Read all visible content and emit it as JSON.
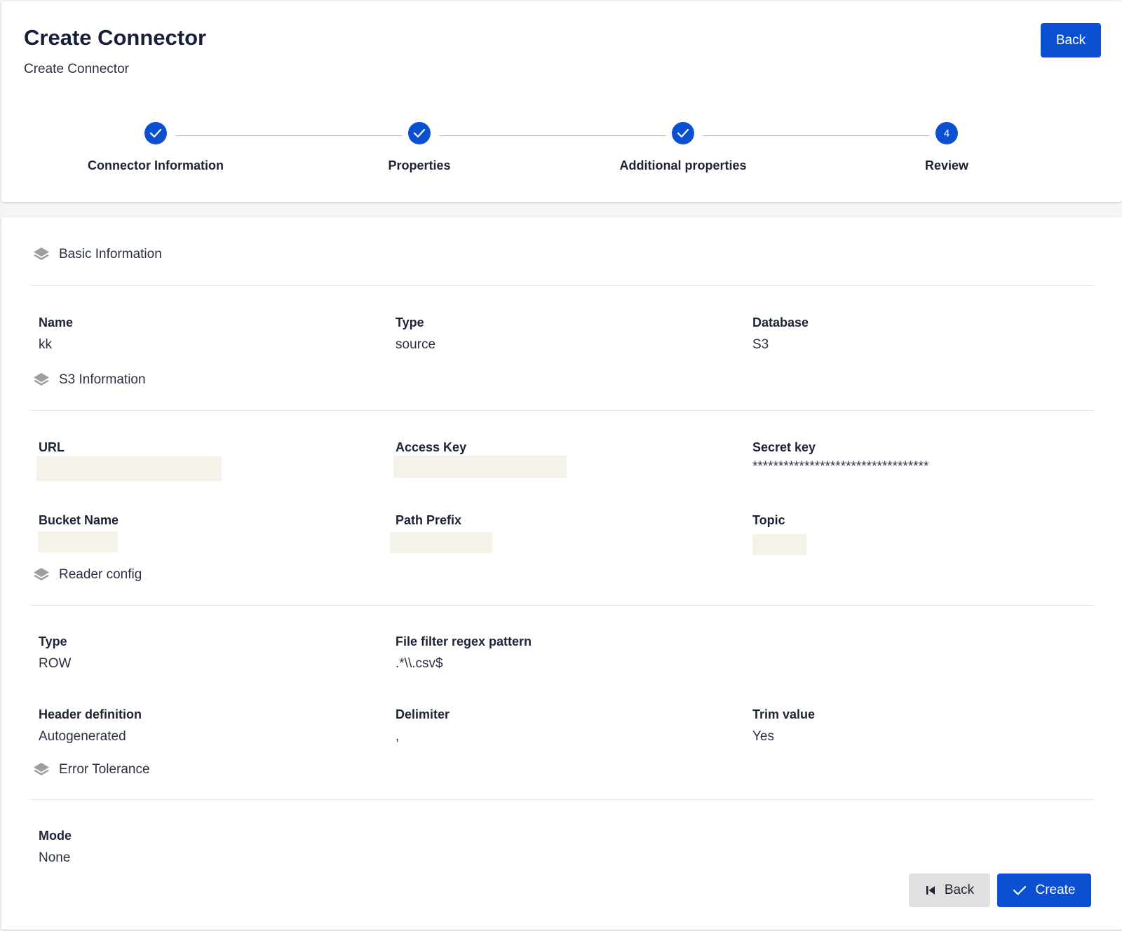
{
  "header": {
    "title": "Create Connector",
    "subtitle": "Create Connector",
    "back_label": "Back"
  },
  "stepper": {
    "steps": [
      {
        "label": "Connector Information",
        "status": "completed"
      },
      {
        "label": "Properties",
        "status": "completed"
      },
      {
        "label": "Additional properties",
        "status": "completed"
      },
      {
        "label": "Review",
        "status": "active",
        "number": "4"
      }
    ]
  },
  "sections": {
    "basic": {
      "title": "Basic Information",
      "fields": {
        "name": {
          "label": "Name",
          "value": "kk"
        },
        "type": {
          "label": "Type",
          "value": "source"
        },
        "database": {
          "label": "Database",
          "value": "S3"
        }
      }
    },
    "s3": {
      "title": "S3 Information",
      "fields": {
        "url": {
          "label": "URL",
          "value": ""
        },
        "access_key": {
          "label": "Access Key",
          "value": ""
        },
        "secret_key": {
          "label": "Secret key",
          "value": "**********************************"
        },
        "bucket_name": {
          "label": "Bucket Name",
          "value": ""
        },
        "path_prefix": {
          "label": "Path Prefix",
          "value": ""
        },
        "topic": {
          "label": "Topic",
          "value": ""
        }
      }
    },
    "reader": {
      "title": "Reader config",
      "fields": {
        "type": {
          "label": "Type",
          "value": "ROW"
        },
        "file_filter": {
          "label": "File filter regex pattern",
          "value": ".*\\\\.csv$"
        },
        "header_definition": {
          "label": "Header definition",
          "value": "Autogenerated"
        },
        "delimiter": {
          "label": "Delimiter",
          "value": ","
        },
        "trim_value": {
          "label": "Trim value",
          "value": "Yes"
        }
      }
    },
    "error": {
      "title": "Error Tolerance",
      "fields": {
        "mode": {
          "label": "Mode",
          "value": "None"
        }
      }
    }
  },
  "actions": {
    "back_label": "Back",
    "create_label": "Create"
  },
  "colors": {
    "primary": "#0b50d0",
    "secondary_button": "#e0e0e0",
    "redacted": "#f5f3e9"
  }
}
